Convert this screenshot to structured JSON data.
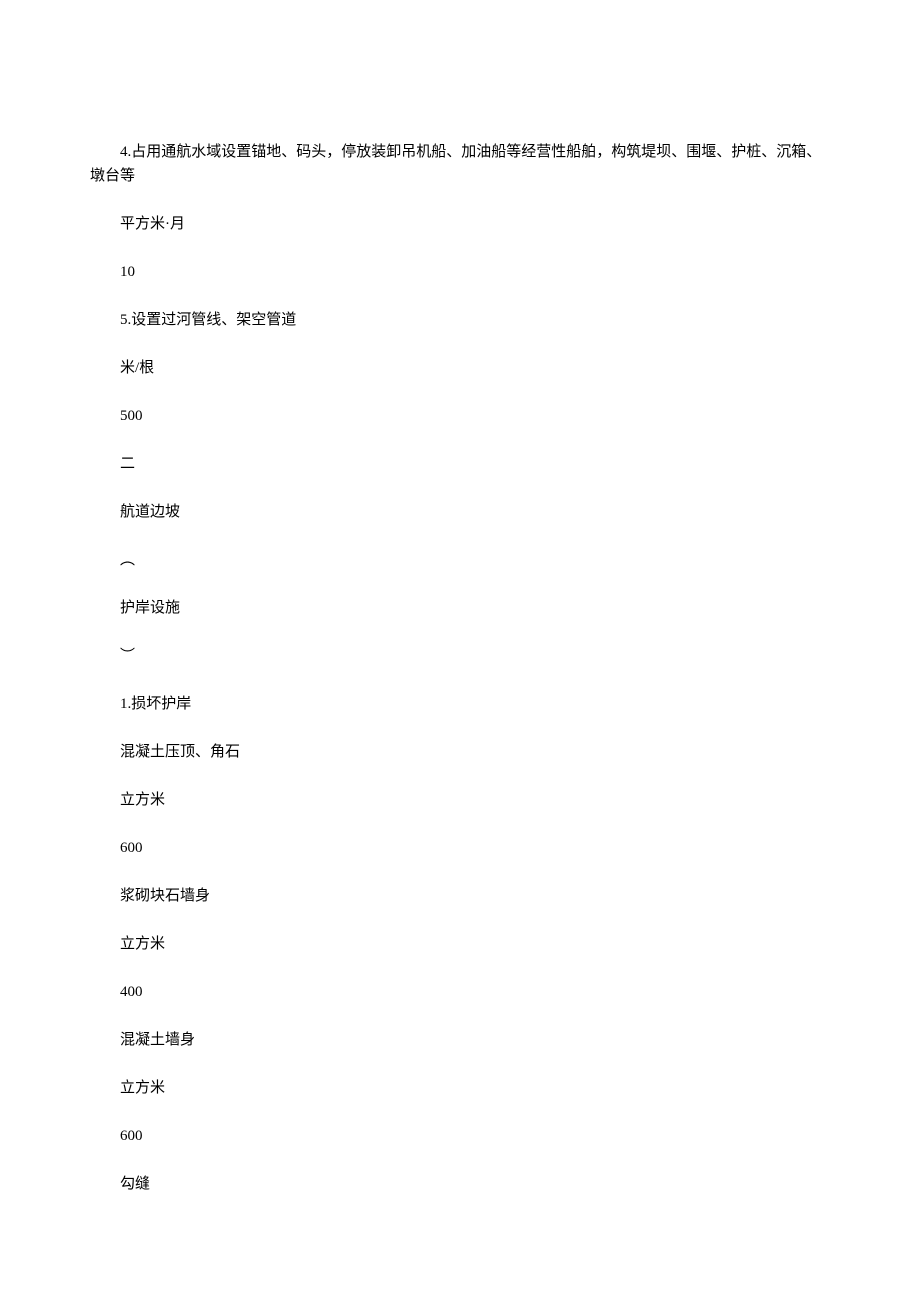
{
  "lines": [
    "4.占用通航水域设置锚地、码头，停放装卸吊机船、加油船等经营性船舶，构筑堤坝、围堰、护桩、沉箱、墩台等",
    "平方米·月",
    "10",
    "5.设置过河管线、架空管道",
    "米/根",
    "500",
    "二",
    "航道边坡",
    "︵",
    "护岸设施",
    "︶",
    "1.损坏护岸",
    "混凝土压顶、角石",
    "立方米",
    "600",
    "浆砌块石墙身",
    "立方米",
    "400",
    "混凝土墙身",
    "立方米",
    "600",
    "勾缝"
  ]
}
